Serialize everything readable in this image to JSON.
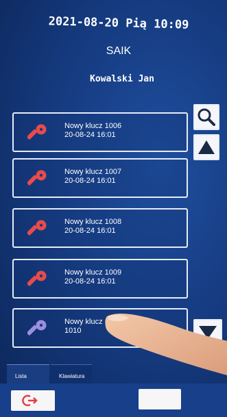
{
  "header": {
    "datetime": "2021-08-20 Pią 10:09",
    "app_title": "SAIK",
    "user_name": "Kowalski Jan"
  },
  "keys": [
    {
      "name": "Nowy klucz 1006",
      "date": "20-08-24 16:01",
      "color": "#e94b4b"
    },
    {
      "name": "Nowy klucz 1007",
      "date": "20-08-24 16:01",
      "color": "#e94b4b"
    },
    {
      "name": "Nowy klucz 1008",
      "date": "20-08-24 16:01",
      "color": "#e94b4b"
    },
    {
      "name": "Nowy klucz 1009",
      "date": "20-08-24 16:01",
      "color": "#e94b4b"
    },
    {
      "name": "Nowy klucz",
      "date": "1010",
      "color": "#9d8fe0"
    }
  ],
  "side_buttons": {
    "search_icon": "magnifier",
    "up_icon": "triangle-up",
    "down_icon": "triangle-down"
  },
  "tabs": [
    {
      "label": "Lista"
    },
    {
      "label": "Klawiatura"
    }
  ],
  "footer": {
    "logout_icon": "logout",
    "accent": "#e63946"
  }
}
